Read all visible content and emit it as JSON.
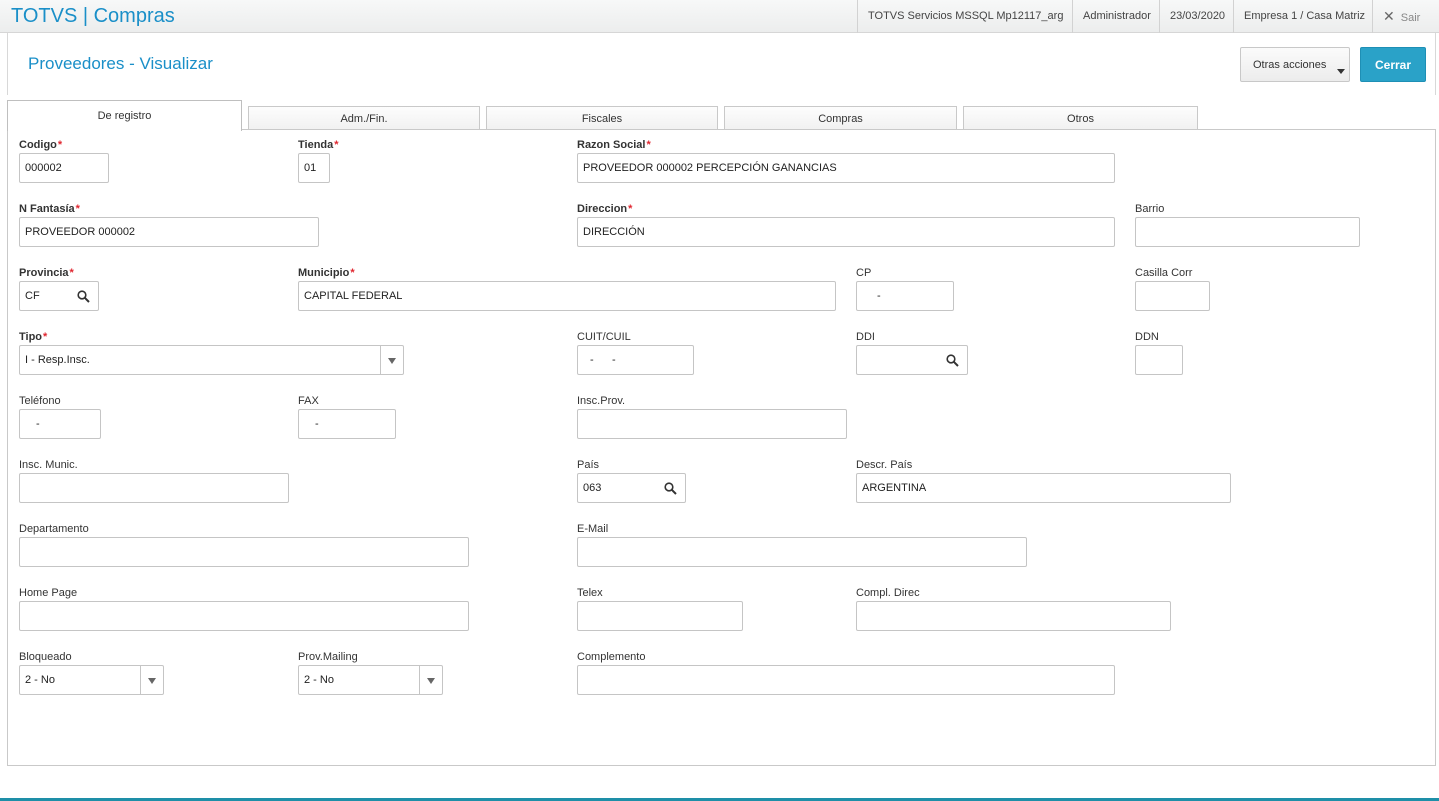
{
  "app": {
    "title": "TOTVS | Compras"
  },
  "topbar": {
    "server": "TOTVS Servicios MSSQL Mp12117_arg",
    "user": "Administrador",
    "date": "23/03/2020",
    "company": "Empresa 1 / Casa Matriz",
    "exit_label": "Sair"
  },
  "header": {
    "title": "Proveedores - Visualizar",
    "other_actions": "Otras acciones",
    "close": "Cerrar"
  },
  "tabs": [
    "De registro",
    "Adm./Fin.",
    "Fiscales",
    "Compras",
    "Otros"
  ],
  "fields": {
    "codigo": {
      "label": "Codigo",
      "value": "000002",
      "required": true
    },
    "tienda": {
      "label": "Tienda",
      "value": "01",
      "required": true
    },
    "razon_social": {
      "label": "Razon Social",
      "value": "PROVEEDOR 000002 PERCEPCIÓN GANANCIAS",
      "required": true
    },
    "n_fantasia": {
      "label": "N Fantasía",
      "value": "PROVEEDOR 000002",
      "required": true
    },
    "direccion": {
      "label": "Direccion",
      "value": "DIRECCIÓN",
      "required": true
    },
    "barrio": {
      "label": "Barrio",
      "value": ""
    },
    "provincia": {
      "label": "Provincia",
      "value": "CF",
      "required": true
    },
    "municipio": {
      "label": "Municipio",
      "value": "CAPITAL FEDERAL",
      "required": true
    },
    "cp": {
      "label": "CP",
      "value": "-"
    },
    "casilla_corr": {
      "label": "Casilla Corr",
      "value": ""
    },
    "tipo": {
      "label": "Tipo",
      "value": "I - Resp.Insc.",
      "required": true
    },
    "cuit_cuil": {
      "label": "CUIT/CUIL",
      "value": "-      -"
    },
    "ddi": {
      "label": "DDI",
      "value": ""
    },
    "ddn": {
      "label": "DDN",
      "value": ""
    },
    "telefono": {
      "label": "Teléfono",
      "value": "-"
    },
    "fax": {
      "label": "FAX",
      "value": "-"
    },
    "insc_prov": {
      "label": "Insc.Prov.",
      "value": ""
    },
    "insc_munic": {
      "label": "Insc. Munic.",
      "value": ""
    },
    "pais": {
      "label": "País",
      "value": "063"
    },
    "descr_pais": {
      "label": "Descr. País",
      "value": "ARGENTINA"
    },
    "departamento": {
      "label": "Departamento",
      "value": ""
    },
    "email": {
      "label": "E-Mail",
      "value": ""
    },
    "home_page": {
      "label": "Home Page",
      "value": ""
    },
    "telex": {
      "label": "Telex",
      "value": ""
    },
    "compl_direc": {
      "label": "Compl. Direc",
      "value": ""
    },
    "bloqueado": {
      "label": "Bloqueado",
      "value": "2 - No"
    },
    "prov_mailing": {
      "label": "Prov.Mailing",
      "value": "2 - No"
    },
    "complemento": {
      "label": "Complemento",
      "value": ""
    }
  },
  "icons": {
    "lookup": "magnifier-icon",
    "dropdown": "chevron-down-icon",
    "exit": "close-icon"
  },
  "colors": {
    "accent": "#1a8fc8",
    "primary_button": "#2aa2c8",
    "required": "#e0262f"
  }
}
